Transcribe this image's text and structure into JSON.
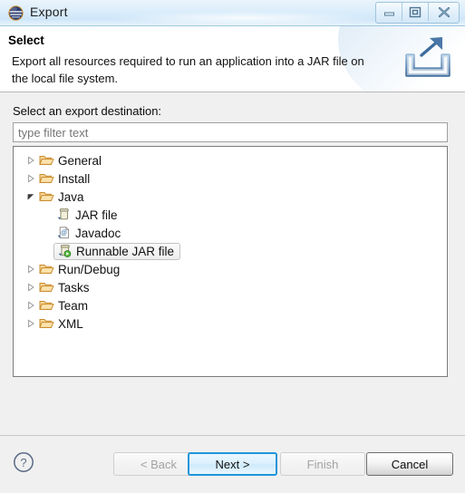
{
  "window": {
    "title": "Export",
    "title_icon": "eclipse-export-sphere-icon",
    "controls": [
      {
        "name": "minimize",
        "glyph": "minimize-icon"
      },
      {
        "name": "restore",
        "glyph": "restore-icon"
      },
      {
        "name": "close",
        "glyph": "close-icon"
      }
    ]
  },
  "header": {
    "title": "Select",
    "description": "Export all resources required to run an application into a JAR file on the local file system.",
    "icon": "export-arrow-icon"
  },
  "form": {
    "destination_label": "Select an export destination:",
    "filter_placeholder": "type filter text",
    "filter_value": ""
  },
  "tree": {
    "items": [
      {
        "label": "General",
        "level": 0,
        "icon": "folder-icon",
        "expanded": false,
        "has_children": true,
        "selected": false
      },
      {
        "label": "Install",
        "level": 0,
        "icon": "folder-icon",
        "expanded": false,
        "has_children": true,
        "selected": false
      },
      {
        "label": "Java",
        "level": 0,
        "icon": "folder-icon",
        "expanded": true,
        "has_children": true,
        "selected": false
      },
      {
        "label": "JAR file",
        "level": 1,
        "icon": "jar-file-icon",
        "expanded": false,
        "has_children": false,
        "selected": false
      },
      {
        "label": "Javadoc",
        "level": 1,
        "icon": "javadoc-icon",
        "expanded": false,
        "has_children": false,
        "selected": false
      },
      {
        "label": "Runnable JAR file",
        "level": 1,
        "icon": "runnable-jar-icon",
        "expanded": false,
        "has_children": false,
        "selected": true
      },
      {
        "label": "Run/Debug",
        "level": 0,
        "icon": "folder-icon",
        "expanded": false,
        "has_children": true,
        "selected": false
      },
      {
        "label": "Tasks",
        "level": 0,
        "icon": "folder-icon",
        "expanded": false,
        "has_children": true,
        "selected": false
      },
      {
        "label": "Team",
        "level": 0,
        "icon": "folder-icon",
        "expanded": false,
        "has_children": true,
        "selected": false
      },
      {
        "label": "XML",
        "level": 0,
        "icon": "folder-icon",
        "expanded": false,
        "has_children": true,
        "selected": false
      }
    ]
  },
  "footer": {
    "help_icon": "help-question-icon",
    "buttons": [
      {
        "label": "< Back",
        "name": "back",
        "state": "disabled"
      },
      {
        "label": "Next >",
        "name": "next",
        "state": "default"
      },
      {
        "label": "Finish",
        "name": "finish",
        "state": "disabled"
      },
      {
        "label": "Cancel",
        "name": "cancel",
        "state": "normal"
      }
    ]
  },
  "colors": {
    "accent_blue": "#1e95d9",
    "titlebar_blue": "#cfe6f8",
    "folder_orange": "#e8a33d",
    "body_gray": "#f0f0f0",
    "selection_gray": "#ededed"
  }
}
